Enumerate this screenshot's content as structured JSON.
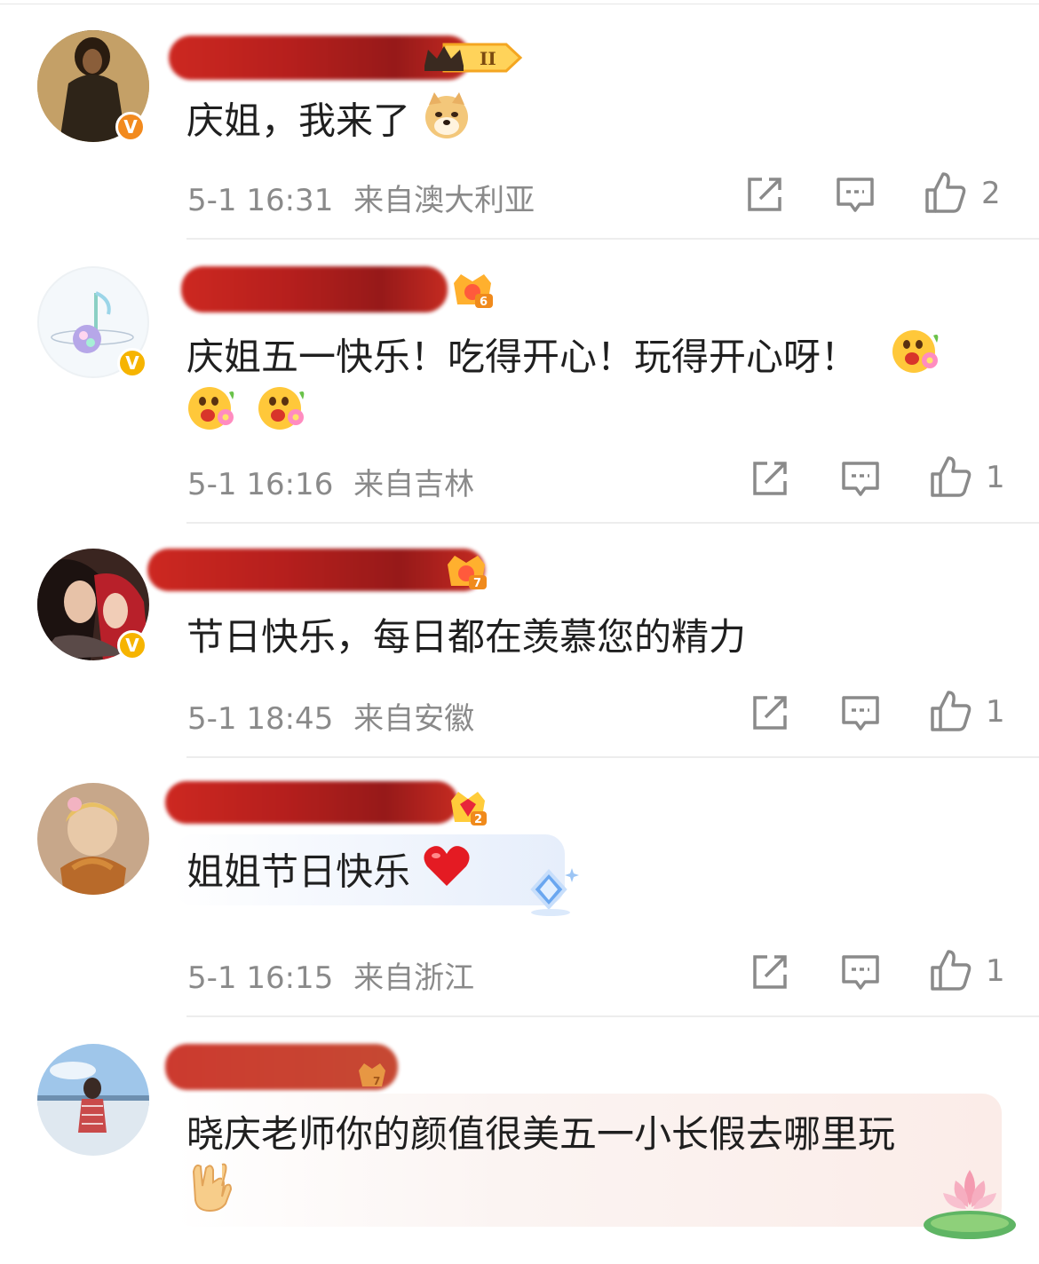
{
  "comments": [
    {
      "text": "庆姐，我来了",
      "emoji": "doge-emoji",
      "time": "5-1 16:31",
      "location": "来自澳大利亚",
      "likes": "2",
      "verified_color": "#f28a1e",
      "level_badge": "II"
    },
    {
      "text_line1": "庆姐五一快乐！吃得开心！玩得开心呀！",
      "emoji": "flower-smile-emoji",
      "time": "5-1 16:16",
      "location": "来自吉林",
      "likes": "1",
      "verified_color": "#f6b400",
      "level_badge": "6"
    },
    {
      "text": "节日快乐，每日都在羡慕您的精力",
      "time": "5-1 18:45",
      "location": "来自安徽",
      "likes": "1",
      "verified_color": "#f6b400",
      "level_badge": "7"
    },
    {
      "text": "姐姐节日快乐",
      "emoji": "red-heart-emoji",
      "time": "5-1 16:15",
      "location": "来自浙江",
      "likes": "1",
      "level_badge": "2"
    },
    {
      "text_line1": "晓庆老师你的颜值很美五一小长假去哪里玩",
      "emoji": "rock-hand-emoji",
      "level_badge": "7"
    }
  ],
  "colors": {
    "meta_gray": "#8a8a8a",
    "icon_gray": "#8a8a8a",
    "redaction": "#b00d0a"
  }
}
